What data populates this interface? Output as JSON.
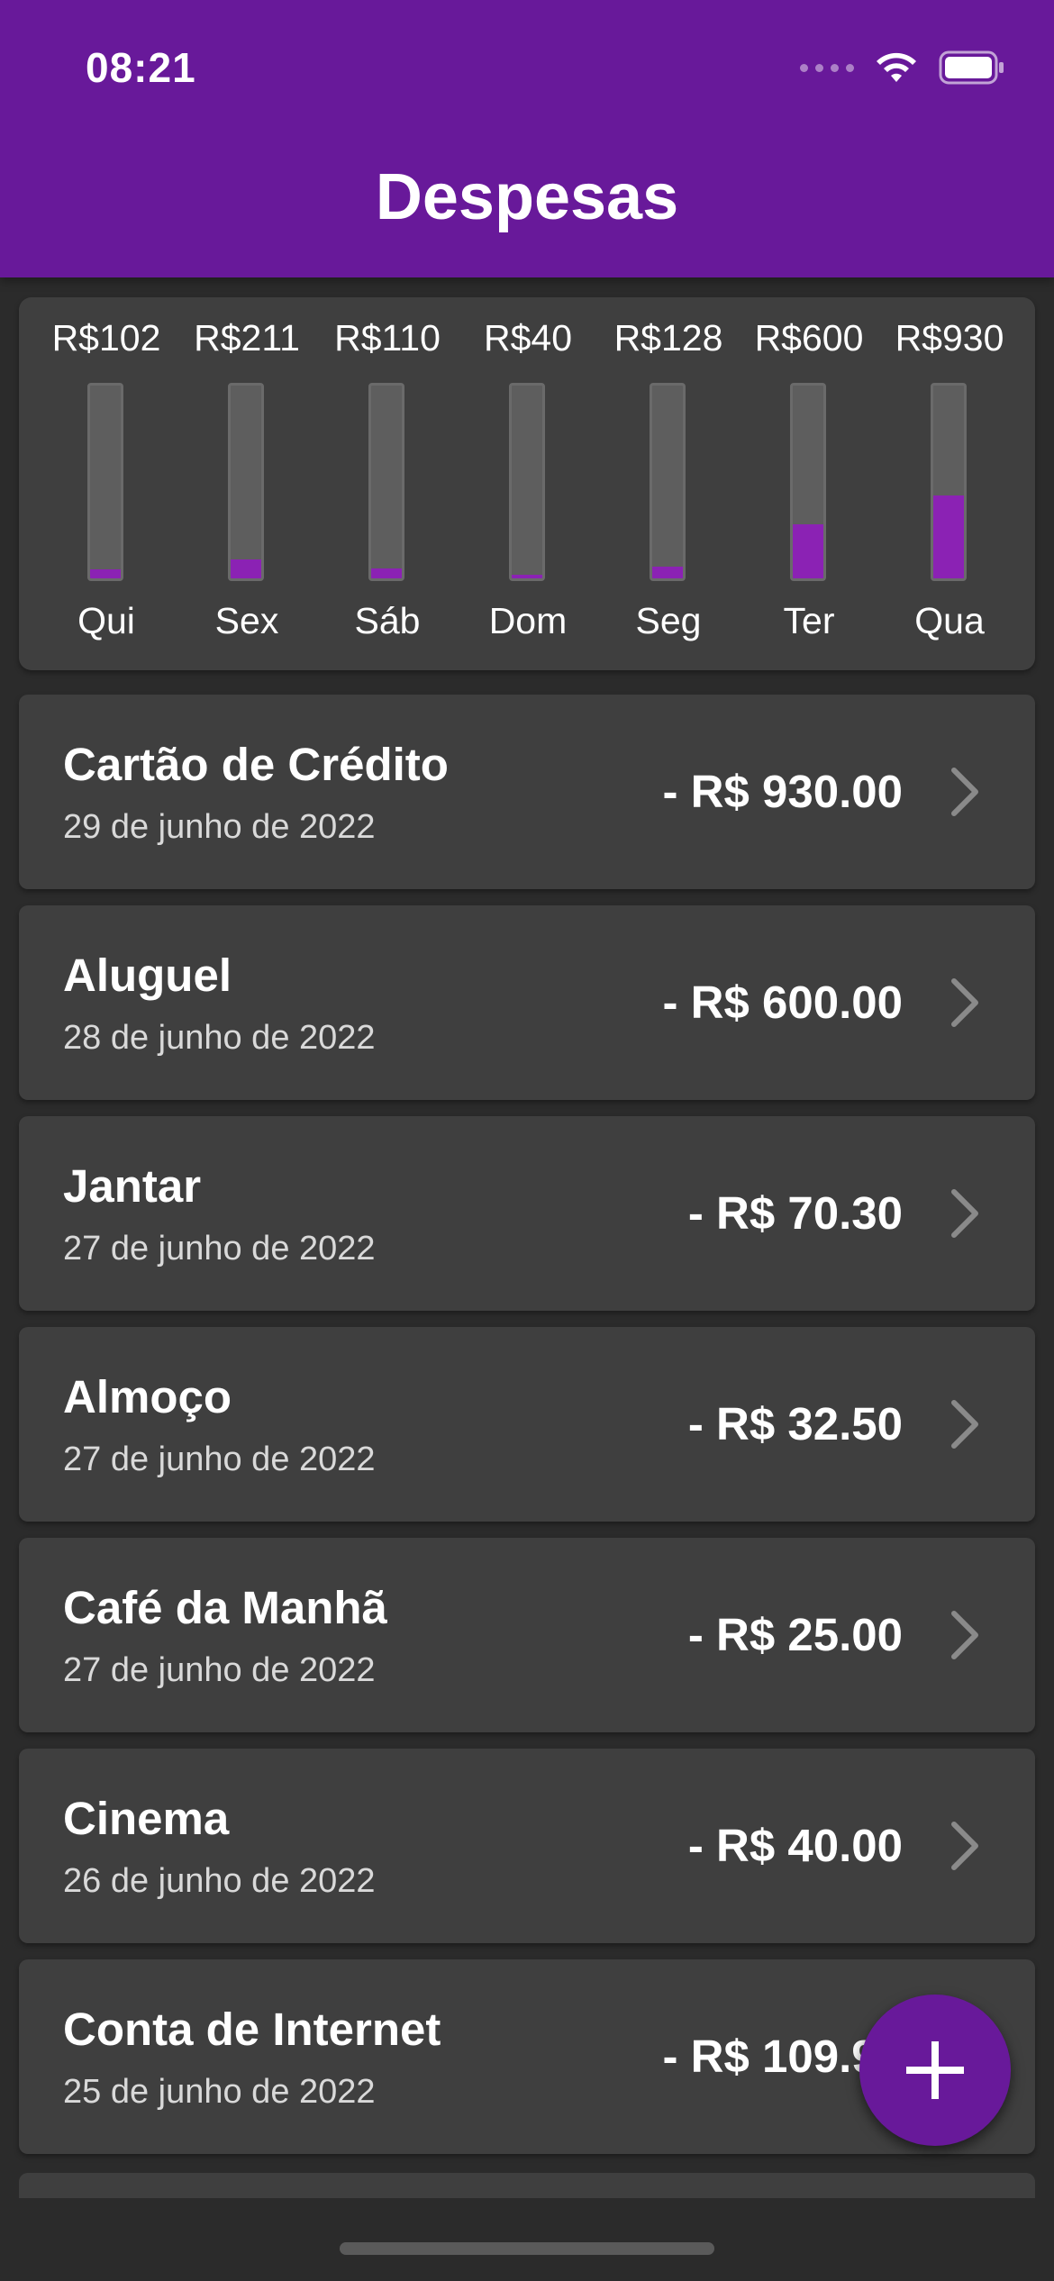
{
  "status_bar": {
    "time": "08:21",
    "icons": [
      "signal-icon",
      "wifi-icon",
      "battery-icon"
    ]
  },
  "app_bar": {
    "title": "Despesas",
    "color": "#68199a"
  },
  "chart_data": {
    "type": "bar",
    "categories": [
      "Qui",
      "Sex",
      "Sáb",
      "Dom",
      "Seg",
      "Ter",
      "Qua"
    ],
    "labels": [
      "R$102",
      "R$211",
      "R$110",
      "R$40",
      "R$128",
      "R$600",
      "R$930"
    ],
    "values": [
      102,
      211,
      110,
      40,
      128,
      600,
      930
    ],
    "fill_fraction_of_week_total": [
      0.048,
      0.098,
      0.051,
      0.019,
      0.059,
      0.279,
      0.432
    ],
    "bar_color": "#8b22b4",
    "track_color": "#5e5e5e"
  },
  "transactions": [
    {
      "title": "Cartão de Crédito",
      "date": "29 de junho de 2022",
      "amount": "- R$ 930.00"
    },
    {
      "title": "Aluguel",
      "date": "28 de junho de 2022",
      "amount": "- R$ 600.00"
    },
    {
      "title": "Jantar",
      "date": "27 de junho de 2022",
      "amount": "- R$ 70.30"
    },
    {
      "title": "Almoço",
      "date": "27 de junho de 2022",
      "amount": "- R$ 32.50"
    },
    {
      "title": "Café da Manhã",
      "date": "27 de junho de 2022",
      "amount": "- R$ 25.00"
    },
    {
      "title": "Cinema",
      "date": "26 de junho de 2022",
      "amount": "- R$ 40.00"
    },
    {
      "title": "Conta de Internet",
      "date": "25 de junho de 2022",
      "amount": "- R$ 109.90"
    }
  ],
  "fab": {
    "icon": "plus-icon",
    "color": "#68199a"
  }
}
